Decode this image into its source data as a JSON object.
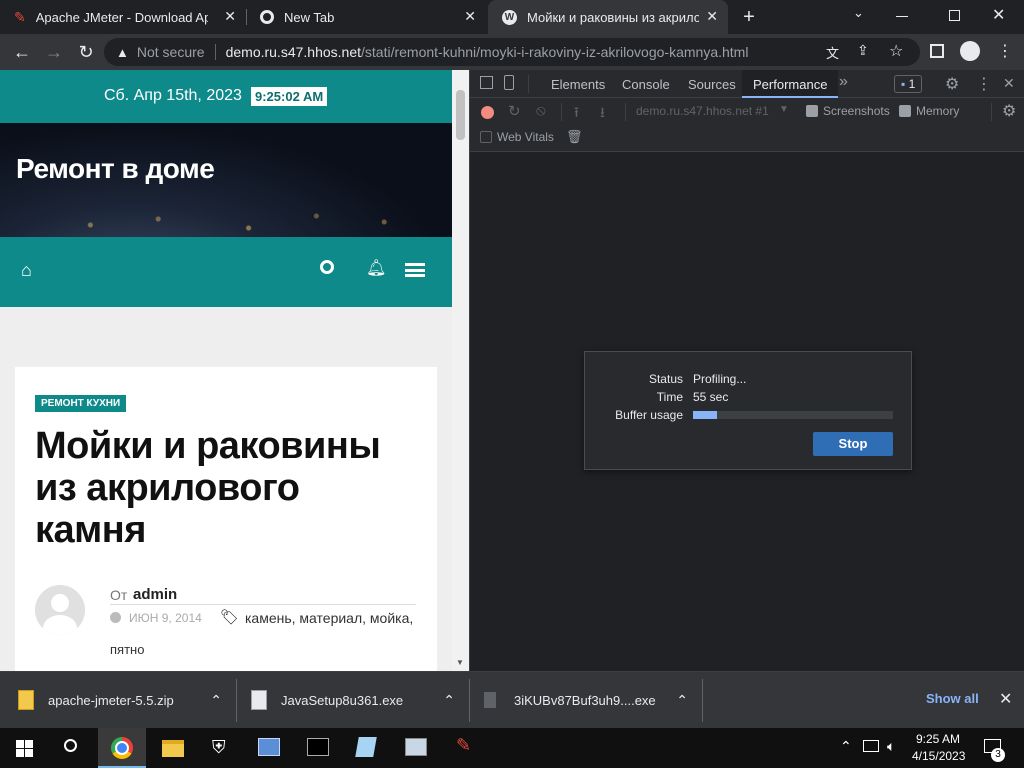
{
  "tabs": [
    {
      "title": "Apache JMeter - Download Apac",
      "icon": "feather-icon"
    },
    {
      "title": "New Tab",
      "icon": "chrome-icon"
    },
    {
      "title": "Мойки и раковины из акрилово",
      "icon": "wordpress-icon"
    }
  ],
  "omnibox": {
    "security": "Not secure",
    "host": "demo.ru.s47.hhos.net",
    "path": "/stati/remont-kuhni/moyki-i-rakoviny-iz-akrilovogo-kamnya.html"
  },
  "site": {
    "date": "Сб. Апр 15th, 2023",
    "time": "9:25:02 AM",
    "site_title": "Ремонт в доме",
    "category": "РЕМОНТ КУХНИ",
    "article_title_lines": [
      "Мойки и раковины",
      "из акрилового",
      "камня"
    ],
    "author_prefix": "От",
    "author": "admin",
    "date_posted": "ИЮН 9, 2014",
    "tags": "камень, материал, мойка,",
    "tags_more": "пятно"
  },
  "devtools": {
    "tabs": [
      "Elements",
      "Console",
      "Sources",
      "Performance"
    ],
    "active_tab": "Performance",
    "issues_count": "1",
    "target": "demo.ru.s47.hhos.net #1",
    "screenshots_label": "Screenshots",
    "memory_label": "Memory",
    "webvitals_label": "Web Vitals",
    "status_label": "Status",
    "status_value": "Profiling...",
    "time_label": "Time",
    "time_value": "55 sec",
    "buffer_label": "Buffer usage",
    "buffer_fraction": 0.12,
    "stop_label": "Stop"
  },
  "downloads": {
    "items": [
      "apache-jmeter-5.5.zip",
      "JavaSetup8u361.exe",
      "3iKUBv87Buf3uh9....exe"
    ],
    "show_all": "Show all"
  },
  "taskbar": {
    "time": "9:25 AM",
    "date": "4/15/2023",
    "notifications": "3"
  },
  "colors": {
    "teal": "#0e8a8a",
    "accent_blue": "#1a73e8",
    "stop_button": "#2f6eb5"
  }
}
